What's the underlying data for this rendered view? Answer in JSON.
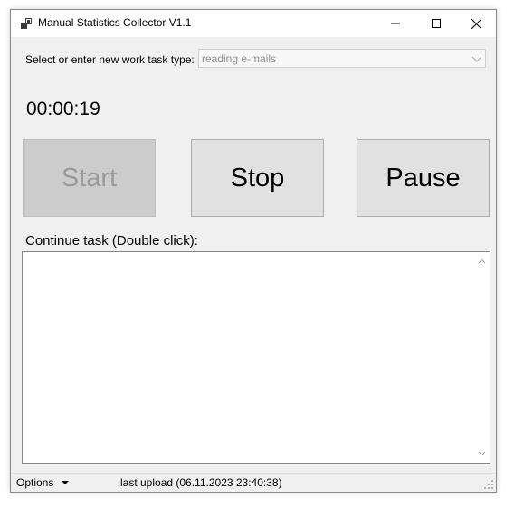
{
  "window": {
    "title": "Manual Statistics Collector V1.1"
  },
  "task_type": {
    "label": "Select or enter new work task type:",
    "value": "reading e-mails"
  },
  "timer": "00:00:19",
  "buttons": {
    "start": "Start",
    "stop": "Stop",
    "pause": "Pause"
  },
  "continue_task": {
    "label": "Continue task (Double click):",
    "items": []
  },
  "statusbar": {
    "options_label": "Options",
    "last_upload": "last upload (06.11.2023 23:40:38)"
  },
  "colors": {
    "window_bg": "#f0f0f0",
    "button_bg": "#e1e1e1",
    "disabled_button_bg": "#cccccc",
    "disabled_text": "#9a9a9a"
  }
}
